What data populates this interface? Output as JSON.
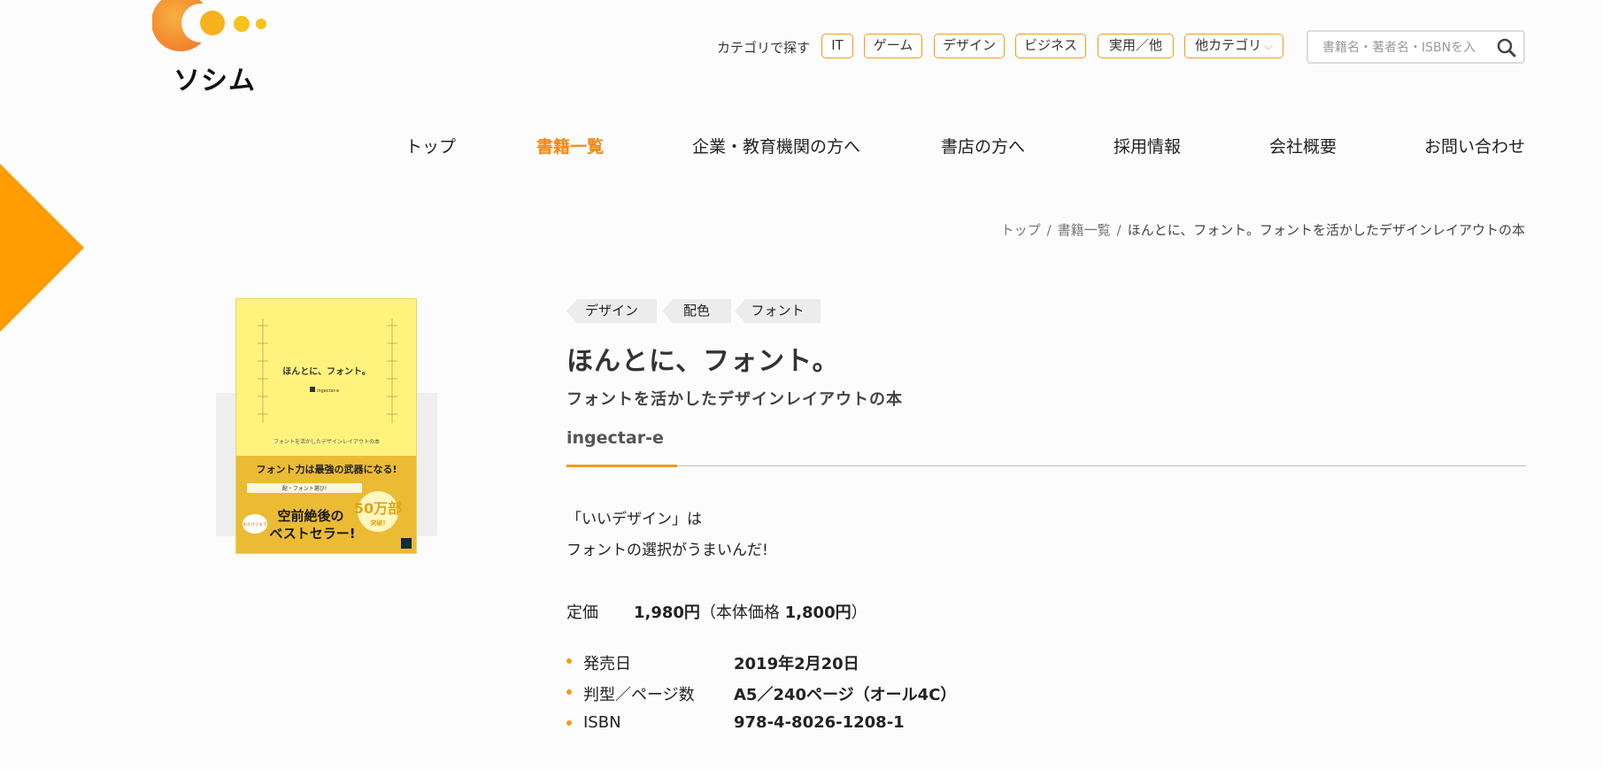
{
  "brand": {
    "logo_text": "ソシム",
    "colors": {
      "accent": "#f29a1f",
      "nav_active": "#ef8a1c"
    }
  },
  "header": {
    "category_label": "カテゴリで探す",
    "categories": [
      "IT",
      "ゲーム",
      "デザイン",
      "ビジネス",
      "実用／他",
      "他カテゴリ"
    ],
    "search": {
      "placeholder": "書籍名・著者名・ISBNを入",
      "icon": "search-icon"
    }
  },
  "nav": {
    "items": [
      "トップ",
      "書籍一覧",
      "企業・教育機関の方へ",
      "書店の方へ",
      "採用情報",
      "会社概要",
      "お問い合わせ"
    ],
    "active": "書籍一覧"
  },
  "breadcrumb": {
    "items": [
      "トップ",
      "書籍一覧"
    ],
    "separator": "/",
    "current": "ほんとに、フォント。フォントを活かしたデザインレイアウトの本"
  },
  "cover": {
    "title": "ほんとに、フォント。",
    "author_mark": "ingectar-e",
    "subtitle": "フォントを活かしたデザインレイアウトの本",
    "banner": "フォント力は最強の武器になる!",
    "row_text": "配・フォント選び!",
    "badge_small": "おかげさまで",
    "bestseller": "空前絶後の\nベストセラー!",
    "seal_big": "50万部",
    "seal_small": "突破!"
  },
  "book": {
    "tags": [
      "デザイン",
      "配色",
      "フォント"
    ],
    "title": "ほんとに、フォント。",
    "subtitle": "フォントを活かしたデザインレイアウトの本",
    "author": "ingectar-e",
    "description": [
      "「いいデザイン」は",
      "フォントの選択がうまいんだ!"
    ],
    "price": {
      "label": "定価",
      "value": "1,980円",
      "detail_prefix": "（本体価格 ",
      "detail_value": "1,800円",
      "detail_suffix": "）"
    },
    "specs": [
      {
        "label": "発売日",
        "value": "2019年2月20日"
      },
      {
        "label": "判型／ページ数",
        "value": "A5／240ページ（オール4C）"
      },
      {
        "label": "ISBN",
        "value": "978-4-8026-1208-1"
      }
    ]
  }
}
